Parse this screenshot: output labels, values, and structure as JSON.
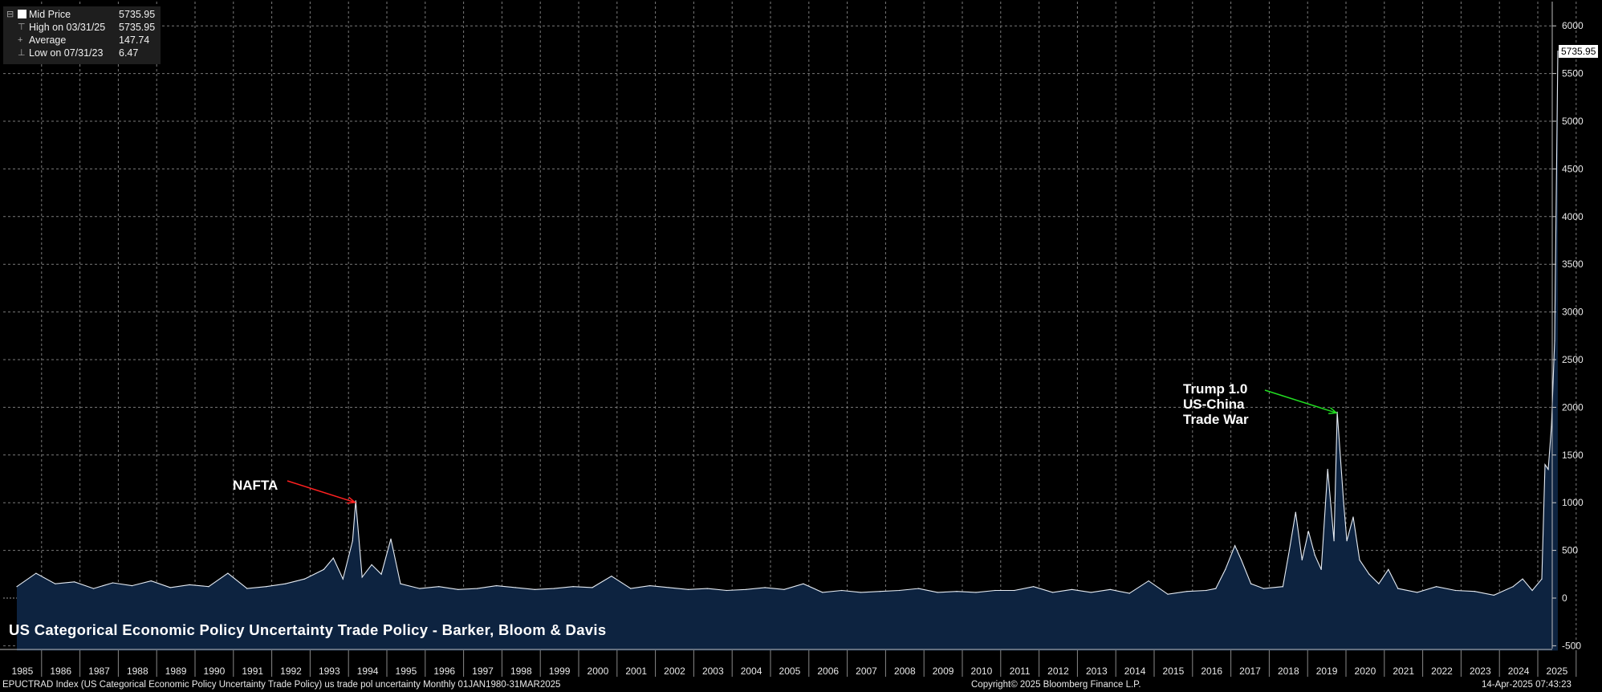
{
  "title": "US Categorical Economic Policy Uncertainty Trade Policy - Barker, Bloom & Davis",
  "legend": {
    "rows": [
      {
        "label": "Mid Price",
        "value": "5735.95",
        "glyph": "⊟",
        "swatch": true
      },
      {
        "label": "High on 03/31/25",
        "value": "5735.95",
        "glyph": "⊤",
        "swatch": false
      },
      {
        "label": "Average",
        "value": "147.74",
        "glyph": "+",
        "swatch": false
      },
      {
        "label": "Low on 07/31/23",
        "value": "6.47",
        "glyph": "⊥",
        "swatch": false
      }
    ]
  },
  "last_value_label": "5735.95",
  "annotations": [
    {
      "text": "NAFTA",
      "color": "#ff2020"
    },
    {
      "text": "Trump 1.0\nUS-China\nTrade War",
      "color": "#22dd22"
    }
  ],
  "footer": {
    "left": "EPUCTRAD Index (US Categorical Economic Policy Uncertainty Trade Policy) us trade pol uncertainty  Monthly 01JAN1980-31MAR2025",
    "center": "Copyright© 2025 Bloomberg Finance L.P.",
    "right": "14-Apr-2025 07:43:23"
  },
  "colors": {
    "background": "#000000",
    "line": "#e6ecf4",
    "area": "#0d2340",
    "grid": "#7a7a7a"
  },
  "chart_data": {
    "type": "area",
    "title": "US Categorical Economic Policy Uncertainty Trade Policy - Barker, Bloom & Davis",
    "xlabel": "",
    "ylabel": "",
    "ylim": [
      -550,
      6250
    ],
    "yticks": [
      -500,
      0,
      500,
      1000,
      1500,
      2000,
      2500,
      3000,
      3500,
      4000,
      4500,
      5000,
      5500,
      6000
    ],
    "xticks": [
      "1985",
      "1986",
      "1987",
      "1988",
      "1989",
      "1990",
      "1991",
      "1992",
      "1993",
      "1994",
      "1995",
      "1996",
      "1997",
      "1998",
      "1999",
      "2000",
      "2001",
      "2002",
      "2003",
      "2004",
      "2005",
      "2006",
      "2007",
      "2008",
      "2009",
      "2010",
      "2011",
      "2012",
      "2013",
      "2014",
      "2015",
      "2016",
      "2017",
      "2018",
      "2019",
      "2020",
      "2021",
      "2022",
      "2023",
      "2024",
      "2025"
    ],
    "grid": true,
    "x": [
      "1985-01",
      "1985-07",
      "1986-01",
      "1986-07",
      "1987-01",
      "1987-07",
      "1988-01",
      "1988-07",
      "1989-01",
      "1989-07",
      "1990-01",
      "1990-07",
      "1991-01",
      "1991-07",
      "1992-01",
      "1992-07",
      "1993-01",
      "1993-04",
      "1993-07",
      "1993-10",
      "1993-11",
      "1994-01",
      "1994-04",
      "1994-07",
      "1994-10",
      "1995-01",
      "1995-07",
      "1996-01",
      "1996-07",
      "1997-01",
      "1997-07",
      "1998-01",
      "1998-07",
      "1999-01",
      "1999-07",
      "2000-01",
      "2000-07",
      "2001-01",
      "2001-07",
      "2002-01",
      "2002-07",
      "2003-01",
      "2003-07",
      "2004-01",
      "2004-07",
      "2005-01",
      "2005-07",
      "2006-01",
      "2006-07",
      "2007-01",
      "2007-07",
      "2008-01",
      "2008-07",
      "2009-01",
      "2009-07",
      "2010-01",
      "2010-07",
      "2011-01",
      "2011-07",
      "2012-01",
      "2012-07",
      "2013-01",
      "2013-07",
      "2014-01",
      "2014-07",
      "2015-01",
      "2015-07",
      "2016-01",
      "2016-04",
      "2016-07",
      "2016-10",
      "2016-12",
      "2017-03",
      "2017-07",
      "2018-01",
      "2018-03",
      "2018-05",
      "2018-07",
      "2018-09",
      "2018-11",
      "2019-01",
      "2019-03",
      "2019-05",
      "2019-06",
      "2019-08",
      "2019-09",
      "2019-11",
      "2020-01",
      "2020-04",
      "2020-07",
      "2020-10",
      "2021-01",
      "2021-07",
      "2022-01",
      "2022-07",
      "2023-01",
      "2023-07",
      "2024-01",
      "2024-04",
      "2024-07",
      "2024-10",
      "2024-11",
      "2024-12",
      "2025-01",
      "2025-02",
      "2025-03"
    ],
    "series": [
      {
        "values": [
          120,
          260,
          150,
          170,
          100,
          160,
          130,
          180,
          110,
          140,
          120,
          260,
          100,
          120,
          150,
          200,
          300,
          420,
          200,
          600,
          1020,
          220,
          350,
          250,
          620,
          150,
          100,
          120,
          90,
          100,
          130,
          110,
          90,
          100,
          120,
          110,
          230,
          100,
          130,
          110,
          90,
          100,
          80,
          90,
          110,
          90,
          150,
          60,
          80,
          60,
          70,
          80,
          100,
          60,
          70,
          60,
          80,
          80,
          120,
          60,
          90,
          60,
          90,
          50,
          180,
          40,
          70,
          80,
          100,
          300,
          550,
          400,
          150,
          100,
          120,
          500,
          900,
          400,
          700,
          450,
          300,
          1350,
          600,
          1950,
          1000,
          600,
          850,
          400,
          250,
          150,
          300,
          100,
          60,
          120,
          80,
          70,
          30,
          120,
          200,
          80,
          200,
          1400,
          1350,
          1800,
          2700,
          5735.95
        ]
      }
    ]
  }
}
